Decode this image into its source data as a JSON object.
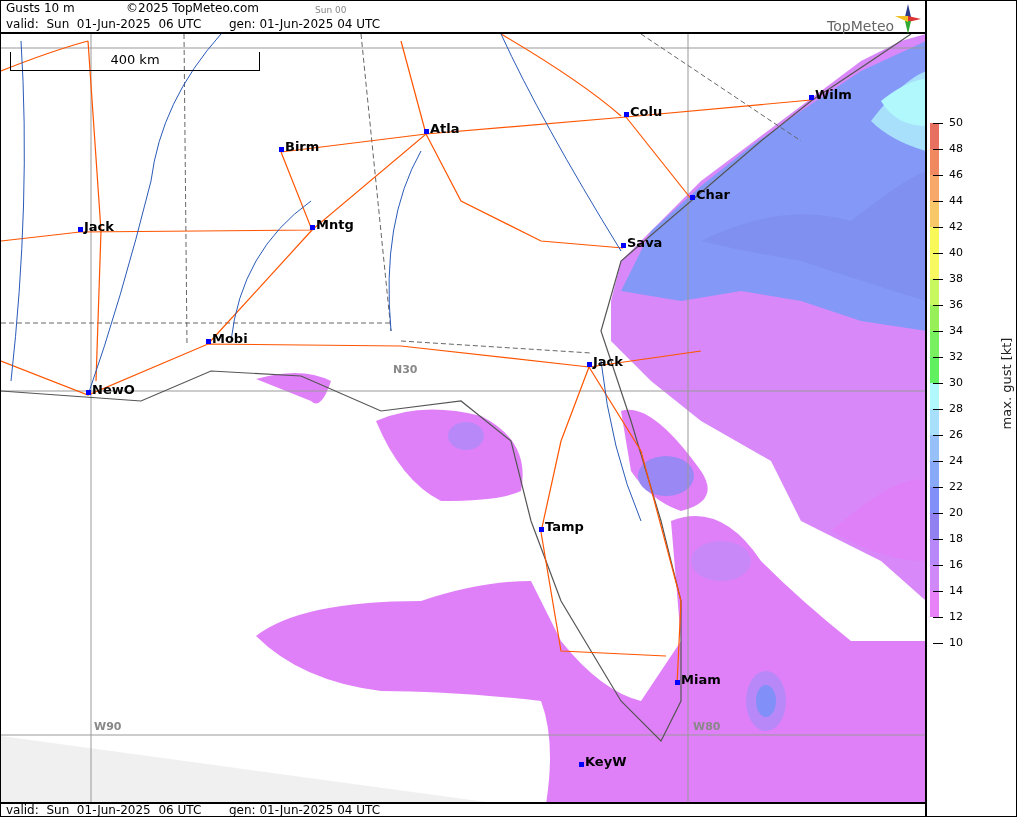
{
  "header": {
    "title": "Gusts 10 m",
    "copyright": "©2025 TopMeteo.com",
    "run": "Sun 00",
    "valid": "valid:  Sun  01-Jun-2025  06 UTC",
    "generated": "gen: 01-Jun-2025 04 UTC",
    "logo": "TopMeteo"
  },
  "map": {
    "scale": "400 km",
    "grid_labels": [
      {
        "text": "N30"
      },
      {
        "text": "W90"
      },
      {
        "text": "W80"
      }
    ],
    "cities": [
      {
        "name": "Wilm"
      },
      {
        "name": "Colu"
      },
      {
        "name": "Atla"
      },
      {
        "name": "Birm"
      },
      {
        "name": "Char"
      },
      {
        "name": "Jack"
      },
      {
        "name": "Mntg"
      },
      {
        "name": "Sava"
      },
      {
        "name": "Mobi"
      },
      {
        "name": "Jack"
      },
      {
        "name": "NewO"
      },
      {
        "name": "Tamp"
      },
      {
        "name": "Miam"
      },
      {
        "name": "KeyW"
      }
    ]
  },
  "legend": {
    "title": "max. gust [kt]",
    "ticks": [
      "50",
      "48",
      "46",
      "44",
      "42",
      "40",
      "38",
      "36",
      "34",
      "32",
      "30",
      "28",
      "26",
      "24",
      "22",
      "20",
      "18",
      "16",
      "14",
      "12",
      "10"
    ],
    "bands": [
      {
        "color": "#e87060"
      },
      {
        "color": "#f08860"
      },
      {
        "color": "#f8a868"
      },
      {
        "color": "#f8c868"
      },
      {
        "color": "#f8f858"
      },
      {
        "color": "#f8f860"
      },
      {
        "color": "#c8f860"
      },
      {
        "color": "#98f058"
      },
      {
        "color": "#78f060"
      },
      {
        "color": "#60f060"
      },
      {
        "color": "#b0f8fc"
      },
      {
        "color": "#a8e0fc"
      },
      {
        "color": "#98c0f8"
      },
      {
        "color": "#88a8f8"
      },
      {
        "color": "#8090f8"
      },
      {
        "color": "#9080f0"
      },
      {
        "color": "#b888f8"
      },
      {
        "color": "#d088f8"
      },
      {
        "color": "#e880f8"
      }
    ]
  },
  "footer": {
    "valid": "valid:  Sun  01-Jun-2025  06 UTC",
    "generated": "gen: 01-Jun-2025 04 UTC"
  }
}
